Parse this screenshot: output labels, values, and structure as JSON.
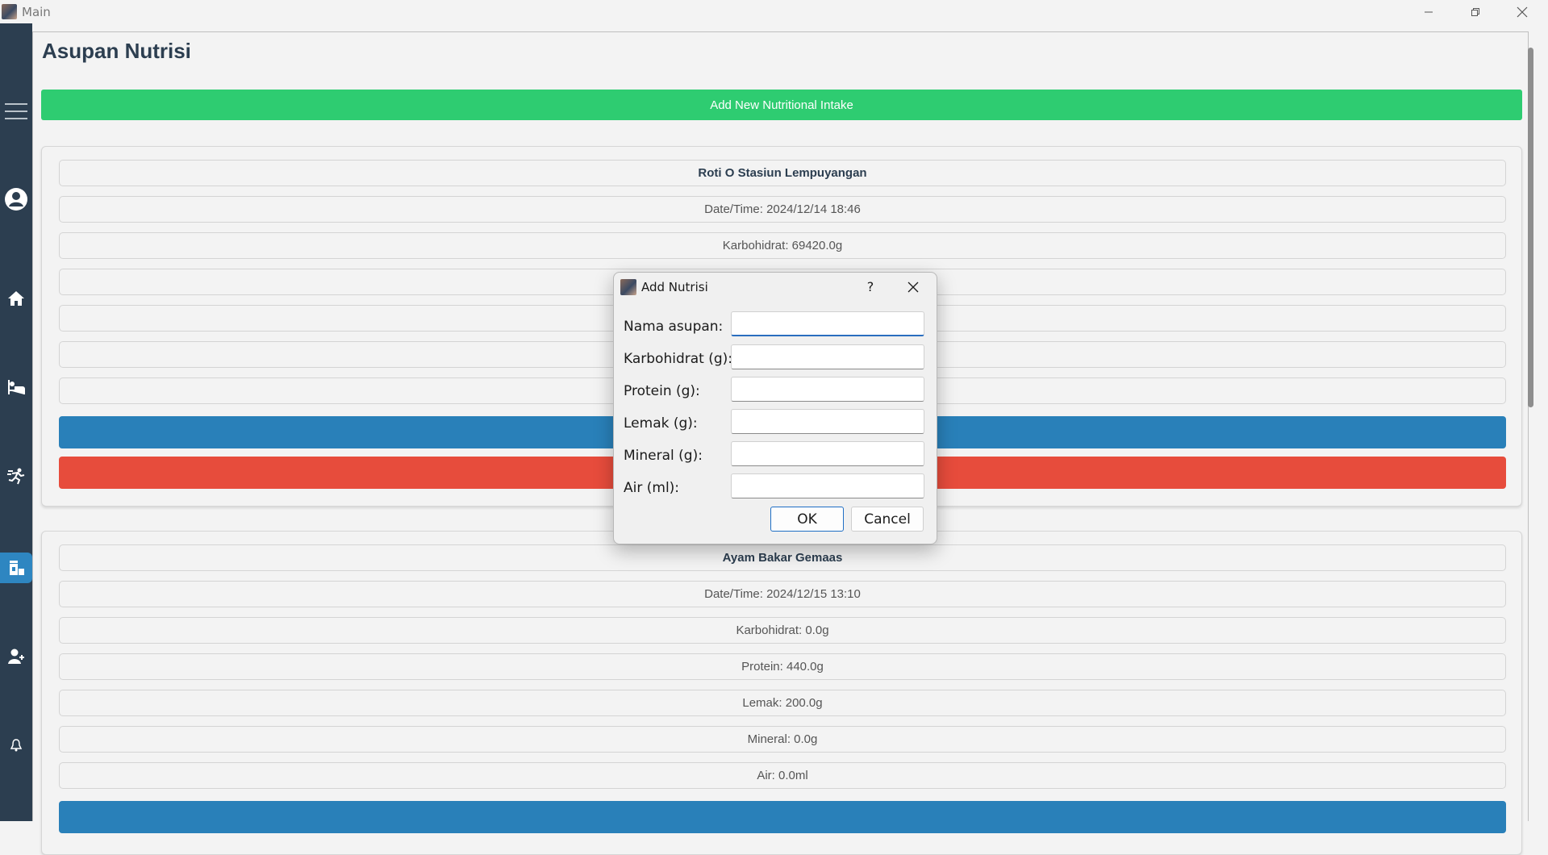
{
  "window": {
    "title": "Main"
  },
  "page": {
    "title": "Asupan Nutrisi",
    "add_button": "Add New Nutritional Intake"
  },
  "cards": [
    {
      "name": "Roti O Stasiun Lempuyangan",
      "datetime": "Date/Time: 2024/12/14 18:46",
      "karbohidrat": "Karbohidrat: 69420.0g"
    },
    {
      "name": "Ayam Bakar Gemaas",
      "datetime": "Date/Time: 2024/12/15 13:10",
      "karbohidrat": "Karbohidrat: 0.0g",
      "protein": "Protein: 440.0g",
      "lemak": "Lemak: 200.0g",
      "mineral": "Mineral: 0.0g",
      "air": "Air: 0.0ml"
    }
  ],
  "sidebar": {
    "items": [
      "menu-icon",
      "user-icon",
      "home-icon",
      "sleep-icon",
      "exercise-icon",
      "nutrition-icon",
      "doctor-icon",
      "bell-icon"
    ],
    "active": "nutrition-icon"
  },
  "dialog": {
    "title": "Add Nutrisi",
    "help": "?",
    "fields": {
      "nama": {
        "label": "Nama asupan:",
        "value": ""
      },
      "karbohidrat": {
        "label": "Karbohidrat (g):",
        "value": ""
      },
      "protein": {
        "label": "Protein (g):",
        "value": ""
      },
      "lemak": {
        "label": "Lemak (g):",
        "value": ""
      },
      "mineral": {
        "label": "Mineral (g):",
        "value": ""
      },
      "air": {
        "label": "Air (ml):",
        "value": ""
      }
    },
    "ok": "OK",
    "cancel": "Cancel"
  },
  "colors": {
    "sidebar": "#2c3e50",
    "active": "#2e86c1",
    "add_button": "#2ecc71",
    "edit_button": "#2980b9",
    "delete_button": "#e74c3c"
  }
}
